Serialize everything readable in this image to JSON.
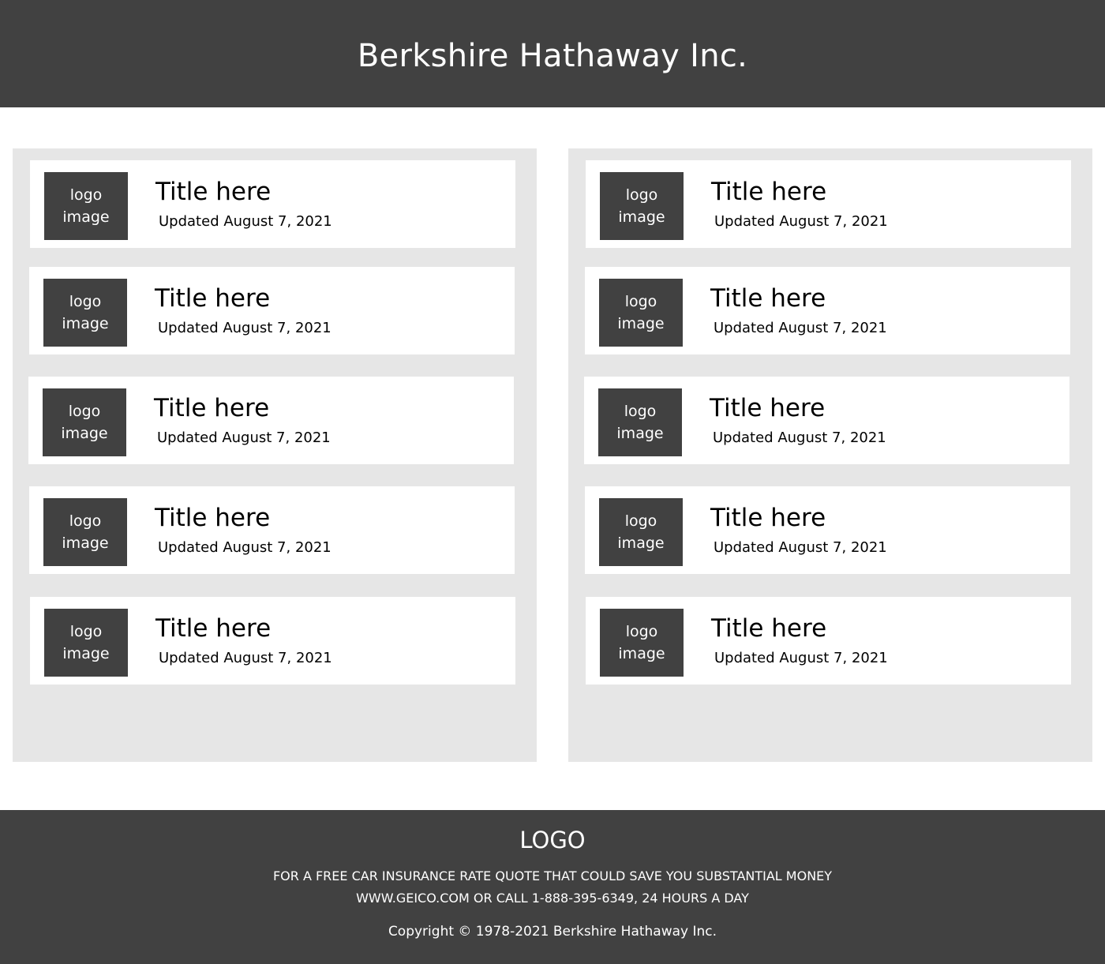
{
  "header": {
    "title": "Berkshire Hathaway Inc."
  },
  "columns": [
    {
      "cards": [
        {
          "logo_line1": "logo",
          "logo_line2": "image",
          "title": "Title here",
          "updated": "Updated August 7, 2021"
        },
        {
          "logo_line1": "logo",
          "logo_line2": "image",
          "title": "Title here",
          "updated": "Updated August 7, 2021"
        },
        {
          "logo_line1": "logo",
          "logo_line2": "image",
          "title": "Title here",
          "updated": "Updated August 7, 2021"
        },
        {
          "logo_line1": "logo",
          "logo_line2": "image",
          "title": "Title here",
          "updated": "Updated August 7, 2021"
        },
        {
          "logo_line1": "logo",
          "logo_line2": "image",
          "title": "Title here",
          "updated": "Updated August 7, 2021"
        }
      ]
    },
    {
      "cards": [
        {
          "logo_line1": "logo",
          "logo_line2": "image",
          "title": "Title here",
          "updated": "Updated August 7, 2021"
        },
        {
          "logo_line1": "logo",
          "logo_line2": "image",
          "title": "Title here",
          "updated": "Updated August 7, 2021"
        },
        {
          "logo_line1": "logo",
          "logo_line2": "image",
          "title": "Title here",
          "updated": "Updated August 7, 2021"
        },
        {
          "logo_line1": "logo",
          "logo_line2": "image",
          "title": "Title here",
          "updated": "Updated August 7, 2021"
        },
        {
          "logo_line1": "logo",
          "logo_line2": "image",
          "title": "Title here",
          "updated": "Updated August 7, 2021"
        }
      ]
    }
  ],
  "footer": {
    "logo": "LOGO",
    "line1": "FOR A FREE CAR INSURANCE RATE QUOTE THAT COULD SAVE YOU SUBSTANTIAL MONEY",
    "line2": "WWW.GEICO.COM OR CALL 1-888-395-6349, 24 HOURS A DAY",
    "copyright": "Copyright © 1978-2021 Berkshire Hathaway Inc."
  },
  "colors": {
    "dark": "#414141",
    "panel": "#e6e6e6",
    "card": "#ffffff"
  }
}
